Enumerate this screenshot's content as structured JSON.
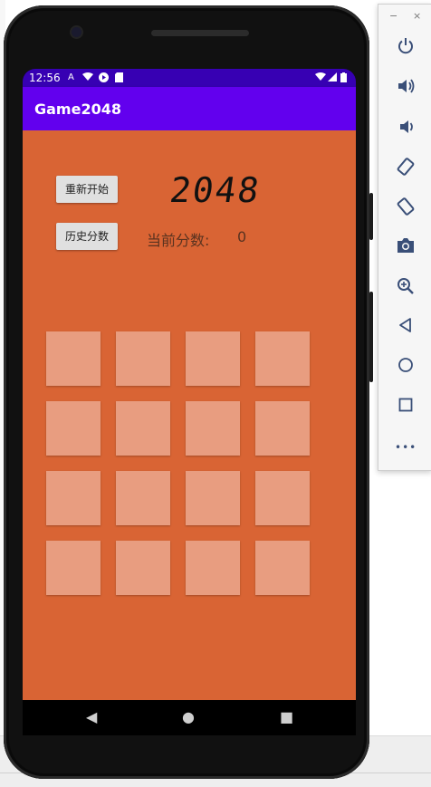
{
  "status_bar": {
    "time": "12:56",
    "left_icons": [
      "sim-a-icon",
      "wifi-icon",
      "play-protect-icon",
      "sd-card-icon"
    ],
    "right_icons": [
      "wifi-signal-icon",
      "cell-signal-icon",
      "battery-icon"
    ]
  },
  "app_bar": {
    "title": "Game2048"
  },
  "game": {
    "restart_label": "重新开始",
    "history_label": "历史分数",
    "logo_text": "2048",
    "score_label": "当前分数:",
    "score_value": "0",
    "grid_rows": 4,
    "grid_cols": 4
  },
  "nav_bar": {
    "back": "◀",
    "home": "●",
    "recents": "■"
  },
  "emulator_toolbar": {
    "minimize": "−",
    "close": "×",
    "buttons": [
      "power-icon",
      "volume-up-icon",
      "volume-down-icon",
      "rotate-left-icon",
      "rotate-right-icon",
      "camera-icon",
      "zoom-icon",
      "back-icon",
      "home-icon",
      "overview-icon",
      "more-icon"
    ],
    "more": "•••"
  },
  "colors": {
    "status_bar": "#3700b3",
    "app_bar": "#6200ee",
    "content_bg": "#d96434",
    "cell_bg": "#e89d80",
    "button_bg": "#e0e0e0",
    "emulator_icon": "#3a4f78"
  }
}
